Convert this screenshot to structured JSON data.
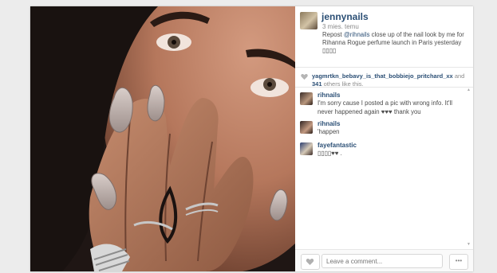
{
  "post": {
    "author": "jennynails",
    "time_ago": "3 mies. temu",
    "caption_prefix": "Repost ",
    "caption_mention": "@rihnails",
    "caption_rest": " close up of the nail look by me for Rihanna Rogue perfume launch in Paris yesterday ▯▯▯▯",
    "photo_alt": "photo"
  },
  "likes": {
    "names": "yagmrtkn_bebavy_is_that_bobbiejo_pritchard_xx",
    "and": " and ",
    "count": "341",
    "suffix": " others like this."
  },
  "comments": [
    {
      "user": "rihnails",
      "text": "I'm sorry cause I posted a pic with wrong info. It'll never happened again ♥♥♥ thank you"
    },
    {
      "user": "rihnails",
      "text": "'happen"
    },
    {
      "user": "fayefantastic",
      "text": "▯▯▯▯♥♥ ."
    }
  ],
  "footer": {
    "comment_placeholder": "Leave a comment...",
    "more_label": "•••"
  },
  "colors": {
    "link": "#2b4f75",
    "text": "#4d4d4d",
    "muted": "#8b8b8b"
  }
}
